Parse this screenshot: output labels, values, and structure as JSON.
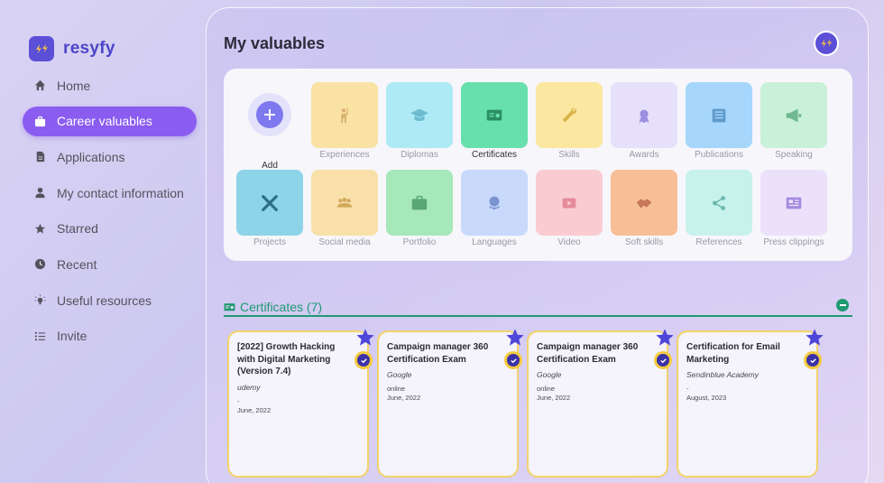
{
  "brand": {
    "name": "resyfy"
  },
  "sidebar": {
    "items": [
      {
        "label": "Home",
        "icon": "home-icon",
        "active": false
      },
      {
        "label": "Career valuables",
        "icon": "briefcase-icon",
        "active": true
      },
      {
        "label": "Applications",
        "icon": "document-icon",
        "active": false
      },
      {
        "label": "My contact information",
        "icon": "person-icon",
        "active": false
      },
      {
        "label": "Starred",
        "icon": "star-icon",
        "active": false
      },
      {
        "label": "Recent",
        "icon": "clock-icon",
        "active": false
      },
      {
        "label": "Useful resources",
        "icon": "lightbulb-icon",
        "active": false
      },
      {
        "label": "Invite",
        "icon": "list-icon",
        "active": false
      }
    ]
  },
  "main": {
    "title": "My valuables",
    "add_label": "Add",
    "categories": [
      {
        "label": "Experiences",
        "icon": "person-raising-hand-icon",
        "color": "#f9e2a4",
        "iconColor": "#d8b06a"
      },
      {
        "label": "Diplomas",
        "icon": "graduation-cap-icon",
        "color": "#aeeaf6",
        "iconColor": "#6cbccf"
      },
      {
        "label": "Certificates",
        "icon": "certificate-icon",
        "color": "#67e0ad",
        "iconColor": "#2a8f63",
        "selected": true
      },
      {
        "label": "Skills",
        "icon": "wrench-icon",
        "color": "#fbe7a0",
        "iconColor": "#d8b54a"
      },
      {
        "label": "Awards",
        "icon": "medal-icon",
        "color": "#e6e0fa",
        "iconColor": "#9c8ee0"
      },
      {
        "label": "Publications",
        "icon": "newspaper-icon",
        "color": "#a6d6fb",
        "iconColor": "#5e9acb"
      },
      {
        "label": "Speaking",
        "icon": "megaphone-icon",
        "color": "#c9f0d9",
        "iconColor": "#6fb890"
      },
      {
        "label": "Projects",
        "icon": "tools-icon",
        "color": "#8ed4e8",
        "iconColor": "#2f6f86"
      },
      {
        "label": "Social media",
        "icon": "people-icon",
        "color": "#f8e0a8",
        "iconColor": "#d2a95c"
      },
      {
        "label": "Portfolio",
        "icon": "briefcase-icon",
        "color": "#a6e8b9",
        "iconColor": "#5aa776"
      },
      {
        "label": "Languages",
        "icon": "globe-icon",
        "color": "#c8d9fb",
        "iconColor": "#7a94d0"
      },
      {
        "label": "Video",
        "icon": "play-icon",
        "color": "#f9ccd2",
        "iconColor": "#e58a99"
      },
      {
        "label": "Soft skills",
        "icon": "handshake-icon",
        "color": "#f8bf97",
        "iconColor": "#c7775a"
      },
      {
        "label": "References",
        "icon": "share-icon",
        "color": "#c7f2ec",
        "iconColor": "#6ab7ad"
      },
      {
        "label": "Press clippings",
        "icon": "press-icon",
        "color": "#ebe1fb",
        "iconColor": "#a58ae0"
      }
    ]
  },
  "section": {
    "title": "Certificates (7)"
  },
  "certificates": [
    {
      "title": "[2022] Growth Hacking with Digital Marketing (Version 7.4)",
      "issuer": "udemy",
      "mode": "-",
      "date": "June, 2022"
    },
    {
      "title": "Campaign manager 360 Certification Exam",
      "issuer": "Google",
      "mode": "online",
      "date": "June, 2022"
    },
    {
      "title": "Campaign manager 360 Certification Exam",
      "issuer": "Google",
      "mode": "online",
      "date": "June, 2022"
    },
    {
      "title": "Certification for Email Marketing",
      "issuer": "Sendinblue Academy",
      "mode": "-",
      "date": "August, 2023"
    }
  ],
  "colors": {
    "accent": "#8b5cf0",
    "brand": "#5b4fd8",
    "section": "#1f9a72",
    "badge": "#f4cb3d"
  }
}
